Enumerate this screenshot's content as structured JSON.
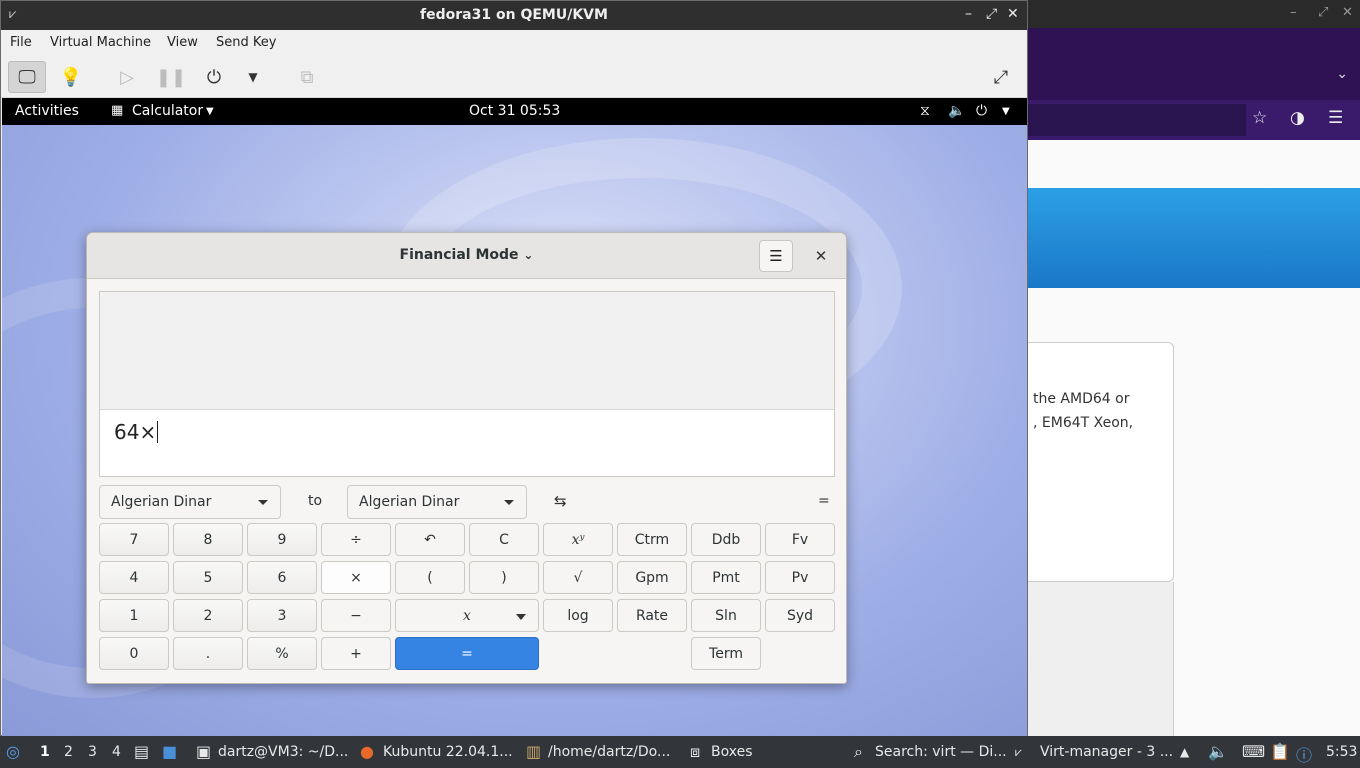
{
  "browser": {
    "menu_chevron": "chevron-down-icon",
    "card_line1": "the AMD64 or",
    "card_line2": ", EM64T Xeon,"
  },
  "vm_window": {
    "title": "fedora31 on QEMU/KVM",
    "menu": [
      "File",
      "Virtual Machine",
      "View",
      "Send Key"
    ]
  },
  "gnome_bar": {
    "activities": "Activities",
    "app_menu": "Calculator",
    "clock": "Oct 31  05:53"
  },
  "calculator": {
    "mode_title": "Financial Mode",
    "expression": "64×",
    "from_currency": "Algerian Dinar",
    "to_label": "to",
    "to_currency": "Algerian Dinar",
    "swap_symbol": "⇆",
    "result_symbol": "=",
    "keys": {
      "k7": "7",
      "k8": "8",
      "k9": "9",
      "div": "÷",
      "undo": "↶",
      "clear": "C",
      "pow": "xʸ",
      "ctrm": "Ctrm",
      "ddb": "Ddb",
      "fv": "Fv",
      "k4": "4",
      "k5": "5",
      "k6": "6",
      "mul": "×",
      "lparen": "(",
      "rparen": ")",
      "sqrt": "√",
      "gpm": "Gpm",
      "pmt": "Pmt",
      "pv": "Pv",
      "k1": "1",
      "k2": "2",
      "k3": "3",
      "sub": "−",
      "x": "x",
      "log": "log",
      "rate": "Rate",
      "sln": "Sln",
      "syd": "Syd",
      "k0": "0",
      "dot": ".",
      "pct": "%",
      "add": "+",
      "eq": "=",
      "term": "Term"
    }
  },
  "taskbar": {
    "workspaces": [
      "1",
      "2",
      "3",
      "4"
    ],
    "tasks": [
      "dartz@VM3: ~/D...",
      "Kubuntu 22.04.1...",
      "/home/dartz/Do...",
      "Boxes",
      "Search: virt — Di...",
      "Virt-manager - 3 ..."
    ],
    "time": "5:53"
  }
}
